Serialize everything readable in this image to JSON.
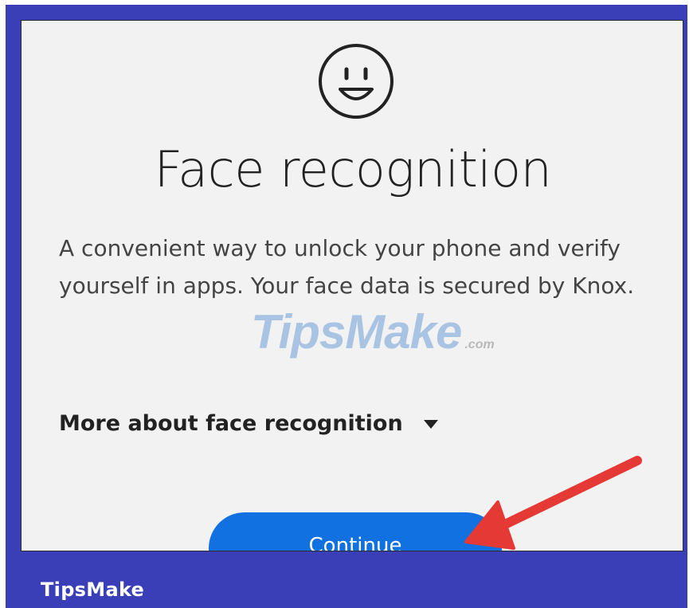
{
  "screen": {
    "title": "Face recognition",
    "description": "A convenient way to unlock your phone and verify yourself in apps. Your face data is secured by Knox.",
    "more_label": "More about face recognition",
    "continue_label": "Continue"
  },
  "watermark": {
    "main": "TipsMake",
    "suffix": ".com"
  },
  "footer": {
    "brand": "TipsMake"
  },
  "colors": {
    "frame": "#3a3fb8",
    "button": "#1271e0",
    "arrow": "#e53935",
    "screen_bg": "#f2f2f2"
  },
  "icons": [
    "smiley-face-icon",
    "caret-down-icon",
    "annotation-arrow"
  ]
}
